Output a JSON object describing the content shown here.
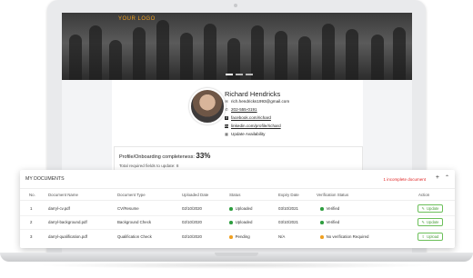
{
  "app": {
    "logo_text": "YOUR LOGO"
  },
  "profile": {
    "name": "Richard Hendricks",
    "email": "rich.hendricks1993@gmail.com",
    "phone": "202-555-0191",
    "facebook": "facebook.com/richard",
    "linkedin": "linkedin.com/profile/richard",
    "update_availability": "Update Availability"
  },
  "completeness": {
    "label": "Profile/Onboarding completeness:",
    "percent": "33%",
    "required_text": "Total required fields to update: 8"
  },
  "documents": {
    "title": "MY DOCUMENTS",
    "warning": "1 incomplete document",
    "columns": [
      "No.",
      "Document Name",
      "Document Type",
      "Uploaded Date",
      "Status",
      "Expiry Date",
      "Verification Status",
      "Action"
    ],
    "rows": [
      {
        "no": "1",
        "name": "darryl-cv.pdf",
        "type": "CV/Resume",
        "uploaded": "02/10/2020",
        "status": "Uploaded",
        "status_color": "#2e9e3f",
        "expiry": "03/10/2021",
        "verification": "Verified",
        "verification_color": "#2e9e3f",
        "action": "Update"
      },
      {
        "no": "2",
        "name": "darryl-background.pdf",
        "type": "Background Check",
        "uploaded": "02/10/2020",
        "status": "Uploaded",
        "status_color": "#2e9e3f",
        "expiry": "03/10/2021",
        "verification": "Verified",
        "verification_color": "#2e9e3f",
        "action": "Update"
      },
      {
        "no": "3",
        "name": "darryl-qualification.pdf",
        "type": "Qualification Check",
        "uploaded": "02/10/2020",
        "status": "Pending",
        "status_color": "#f0a020",
        "expiry": "N/A",
        "verification": "No verification Required",
        "verification_color": "#f0a020",
        "action": "Upload"
      }
    ]
  },
  "icons": {
    "email": "envelope-icon",
    "phone": "phone-icon",
    "facebook": "facebook-icon",
    "linkedin": "linkedin-icon",
    "calendar": "calendar-icon",
    "add": "plus-icon",
    "collapse": "chevron-up-icon",
    "update": "edit-icon",
    "upload": "upload-icon"
  }
}
